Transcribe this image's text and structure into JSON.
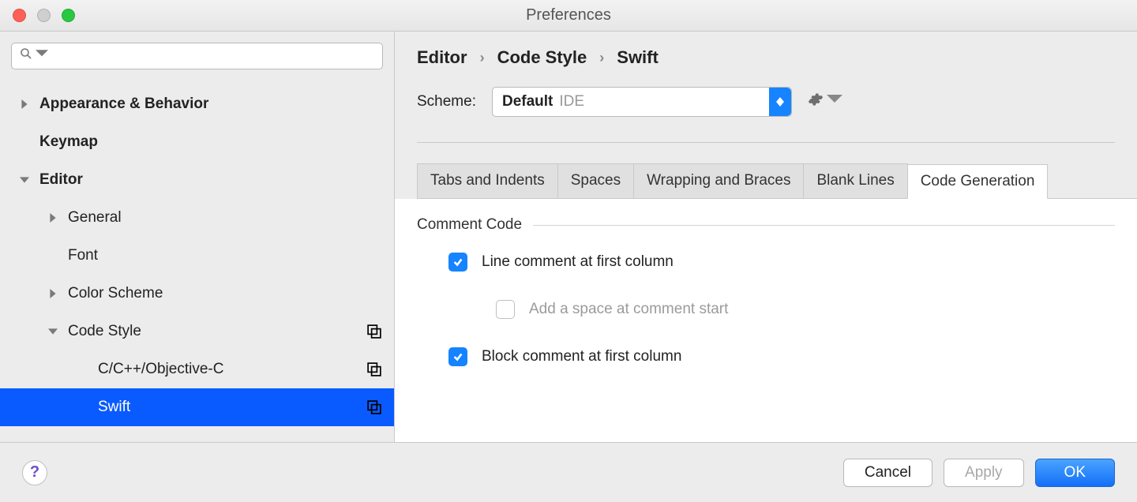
{
  "window": {
    "title": "Preferences"
  },
  "sidebar": {
    "search_placeholder": "",
    "items": [
      {
        "label": "Appearance & Behavior",
        "bold": true
      },
      {
        "label": "Keymap",
        "bold": true
      },
      {
        "label": "Editor",
        "bold": true
      },
      {
        "label": "General"
      },
      {
        "label": "Font"
      },
      {
        "label": "Color Scheme"
      },
      {
        "label": "Code Style"
      },
      {
        "label": "C/C++/Objective-C"
      },
      {
        "label": "Swift"
      }
    ]
  },
  "breadcrumb": {
    "a": "Editor",
    "b": "Code Style",
    "c": "Swift"
  },
  "scheme": {
    "label": "Scheme:",
    "value": "Default",
    "sub": "IDE"
  },
  "tabs": {
    "t0": "Tabs and Indents",
    "t1": "Spaces",
    "t2": "Wrapping and Braces",
    "t3": "Blank Lines",
    "t4": "Code Generation"
  },
  "section": {
    "title": "Comment Code",
    "opt1": "Line comment at first column",
    "opt2": "Add a space at comment start",
    "opt3": "Block comment at first column"
  },
  "footer": {
    "cancel": "Cancel",
    "apply": "Apply",
    "ok": "OK"
  }
}
